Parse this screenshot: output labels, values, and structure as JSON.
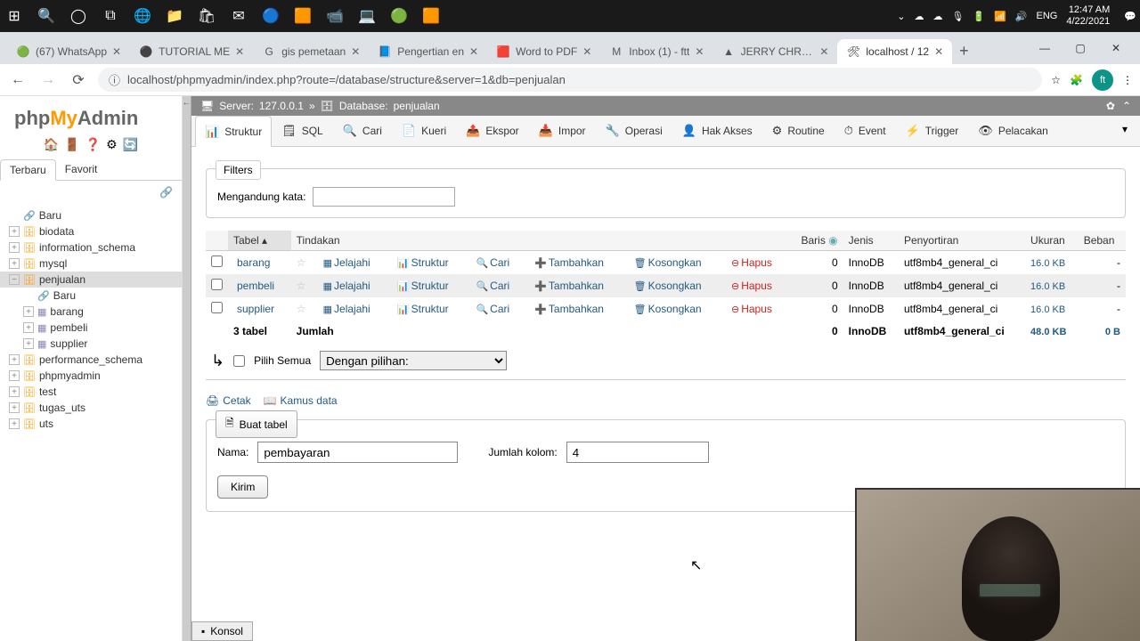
{
  "taskbar": {
    "lang": "ENG",
    "time": "12:47 AM",
    "date": "4/22/2021"
  },
  "tabs": [
    {
      "label": "(67) WhatsApp",
      "fav": "🟢"
    },
    {
      "label": "TUTORIAL ME",
      "fav": "⚫"
    },
    {
      "label": "gis pemetaan",
      "fav": "G"
    },
    {
      "label": "Pengertian en",
      "fav": "📘"
    },
    {
      "label": "Word to PDF",
      "fav": "🟥"
    },
    {
      "label": "Inbox (1) - ftt",
      "fav": "M"
    },
    {
      "label": "JERRY CHRIST",
      "fav": "▲"
    },
    {
      "label": "localhost / 12",
      "fav": "🛠",
      "active": true
    }
  ],
  "url": "localhost/phpmyadmin/index.php?route=/database/structure&server=1&db=penjualan",
  "avatar": "ft",
  "logo": {
    "p1": "php",
    "p2": "My",
    "p3": "Admin"
  },
  "sidebar_tabs": {
    "recent": "Terbaru",
    "fav": "Favorit"
  },
  "tree": {
    "new": "Baru",
    "dbs": [
      "biodata",
      "information_schema",
      "mysql"
    ],
    "current": "penjualan",
    "current_children_new": "Baru",
    "current_children": [
      "barang",
      "pembeli",
      "supplier"
    ],
    "after": [
      "performance_schema",
      "phpmyadmin",
      "test",
      "tugas_uts",
      "uts"
    ]
  },
  "breadcrumb": {
    "server_lbl": "Server:",
    "server": "127.0.0.1",
    "db_lbl": "Database:",
    "db": "penjualan"
  },
  "toptabs": [
    "Struktur",
    "SQL",
    "Cari",
    "Kueri",
    "Ekspor",
    "Impor",
    "Operasi",
    "Hak Akses",
    "Routine",
    "Event",
    "Trigger",
    "Pelacakan"
  ],
  "toptab_icons": [
    "📊",
    "🗒",
    "🔍",
    "📄",
    "📤",
    "📥",
    "🔧",
    "👤",
    "⚙",
    "⏱",
    "⚡",
    "👁"
  ],
  "filters": {
    "legend": "Filters",
    "label": "Mengandung kata:"
  },
  "table": {
    "headers": {
      "tabel": "Tabel",
      "tindakan": "Tindakan",
      "baris": "Baris",
      "jenis": "Jenis",
      "penyortiran": "Penyortiran",
      "ukuran": "Ukuran",
      "beban": "Beban"
    },
    "actions": {
      "jelajahi": "Jelajahi",
      "struktur": "Struktur",
      "cari": "Cari",
      "tambahkan": "Tambahkan",
      "kosongkan": "Kosongkan",
      "hapus": "Hapus"
    },
    "rows": [
      {
        "name": "barang",
        "rows": "0",
        "engine": "InnoDB",
        "collation": "utf8mb4_general_ci",
        "size": "16.0 KB",
        "overhead": "-"
      },
      {
        "name": "pembeli",
        "rows": "0",
        "engine": "InnoDB",
        "collation": "utf8mb4_general_ci",
        "size": "16.0 KB",
        "overhead": "-"
      },
      {
        "name": "supplier",
        "rows": "0",
        "engine": "InnoDB",
        "collation": "utf8mb4_general_ci",
        "size": "16.0 KB",
        "overhead": "-"
      }
    ],
    "total": {
      "label": "3 tabel",
      "sum": "Jumlah",
      "rows": "0",
      "engine": "InnoDB",
      "collation": "utf8mb4_general_ci",
      "size": "48.0 KB",
      "overhead": "0 B"
    }
  },
  "selectall": {
    "label": "Pilih Semua",
    "dropdown": "Dengan pilihan:"
  },
  "tools": {
    "print": "Cetak",
    "dict": "Kamus data"
  },
  "create": {
    "legend": "Buat tabel",
    "name_lbl": "Nama:",
    "name_val": "pembayaran",
    "cols_lbl": "Jumlah kolom:",
    "cols_val": "4",
    "submit": "Kirim"
  },
  "konsol": "Konsol"
}
